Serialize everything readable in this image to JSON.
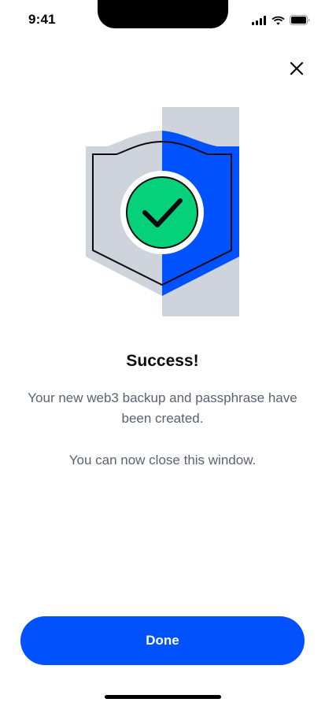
{
  "status_bar": {
    "time": "9:41",
    "icons": [
      "cellular-signal-icon",
      "wifi-icon",
      "battery-icon"
    ]
  },
  "header": {
    "close_icon": "close-icon"
  },
  "illustration": {
    "icon": "shield-checkmark-icon",
    "colors": {
      "shield_blue": "#0052ff",
      "shield_gray": "#cfd3db",
      "check_green": "#05d17a"
    }
  },
  "content": {
    "title": "Success!",
    "message": "Your new web3 backup and passphrase have been created.",
    "message_2": "You can now close this window."
  },
  "footer": {
    "done_label": "Done",
    "accent_color": "#0052ff"
  }
}
